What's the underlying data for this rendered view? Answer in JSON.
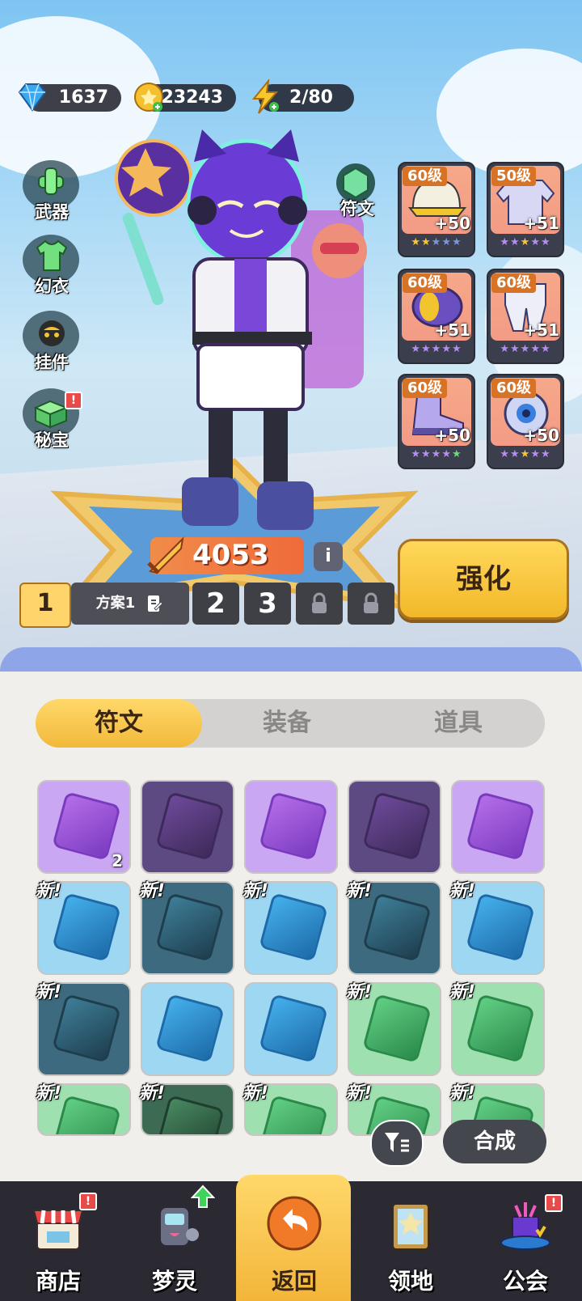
{
  "currencies": [
    {
      "icon": "diamond-icon",
      "value": "1637"
    },
    {
      "icon": "gold-coin-icon",
      "value": "23243"
    },
    {
      "icon": "energy-bolt-icon",
      "value": "2/80"
    }
  ],
  "side_menu": [
    {
      "label": "武器",
      "icon": "weapon-icon"
    },
    {
      "label": "幻衣",
      "icon": "outfit-icon"
    },
    {
      "label": "挂件",
      "icon": "pendant-icon"
    },
    {
      "label": "秘宝",
      "icon": "treasure-icon",
      "badge": "!"
    }
  ],
  "rune_button": {
    "label": "符文",
    "icon": "rune-icon"
  },
  "equipment": [
    {
      "level": "60级",
      "bonus": "+50",
      "stars": "★★★★★",
      "name": "helmet"
    },
    {
      "level": "50级",
      "bonus": "+51",
      "stars": "★★★★★",
      "name": "jacket"
    },
    {
      "level": "60级",
      "bonus": "+51",
      "stars": "★★★★★",
      "name": "belt"
    },
    {
      "level": "60级",
      "bonus": "+51",
      "stars": "★★★★★",
      "name": "pants"
    },
    {
      "level": "60级",
      "bonus": "+50",
      "stars": "★★★★★",
      "name": "shoes"
    },
    {
      "level": "60级",
      "bonus": "+50",
      "stars": "★★★★★",
      "name": "orb"
    }
  ],
  "power": "4053",
  "info_label": "i",
  "strengthen_label": "强化",
  "plans": {
    "active_number": "1",
    "active_name": "方案1",
    "others": [
      "2",
      "3"
    ]
  },
  "tabs": [
    "符文",
    "装备",
    "道具"
  ],
  "active_tab": 0,
  "grid": [
    {
      "color": "purple",
      "new": false,
      "count": "2"
    },
    {
      "color": "purple-dark",
      "new": false
    },
    {
      "color": "purple",
      "new": false
    },
    {
      "color": "purple-dark",
      "new": false
    },
    {
      "color": "purple",
      "new": false
    },
    {
      "color": "blue",
      "new": true
    },
    {
      "color": "blue-dark",
      "new": true
    },
    {
      "color": "blue",
      "new": true
    },
    {
      "color": "blue-dark",
      "new": true
    },
    {
      "color": "blue",
      "new": true
    },
    {
      "color": "blue-dark",
      "new": true
    },
    {
      "color": "blue",
      "new": false
    },
    {
      "color": "blue",
      "new": false
    },
    {
      "color": "green",
      "new": true
    },
    {
      "color": "green",
      "new": true
    },
    {
      "color": "green",
      "new": true
    },
    {
      "color": "green-dark",
      "new": true
    },
    {
      "color": "green",
      "new": true
    },
    {
      "color": "green",
      "new": true
    },
    {
      "color": "green",
      "new": true
    }
  ],
  "new_label": "新!",
  "compose_label": "合成",
  "nav": [
    {
      "label": "商店",
      "icon": "shop-icon",
      "badge": "!"
    },
    {
      "label": "梦灵",
      "icon": "robot-pet-icon",
      "up": true
    },
    {
      "label": "返回",
      "icon": "back-arrow-icon",
      "active": true
    },
    {
      "label": "领地",
      "icon": "territory-door-icon"
    },
    {
      "label": "公会",
      "icon": "guild-hat-icon",
      "badge": "!"
    }
  ]
}
